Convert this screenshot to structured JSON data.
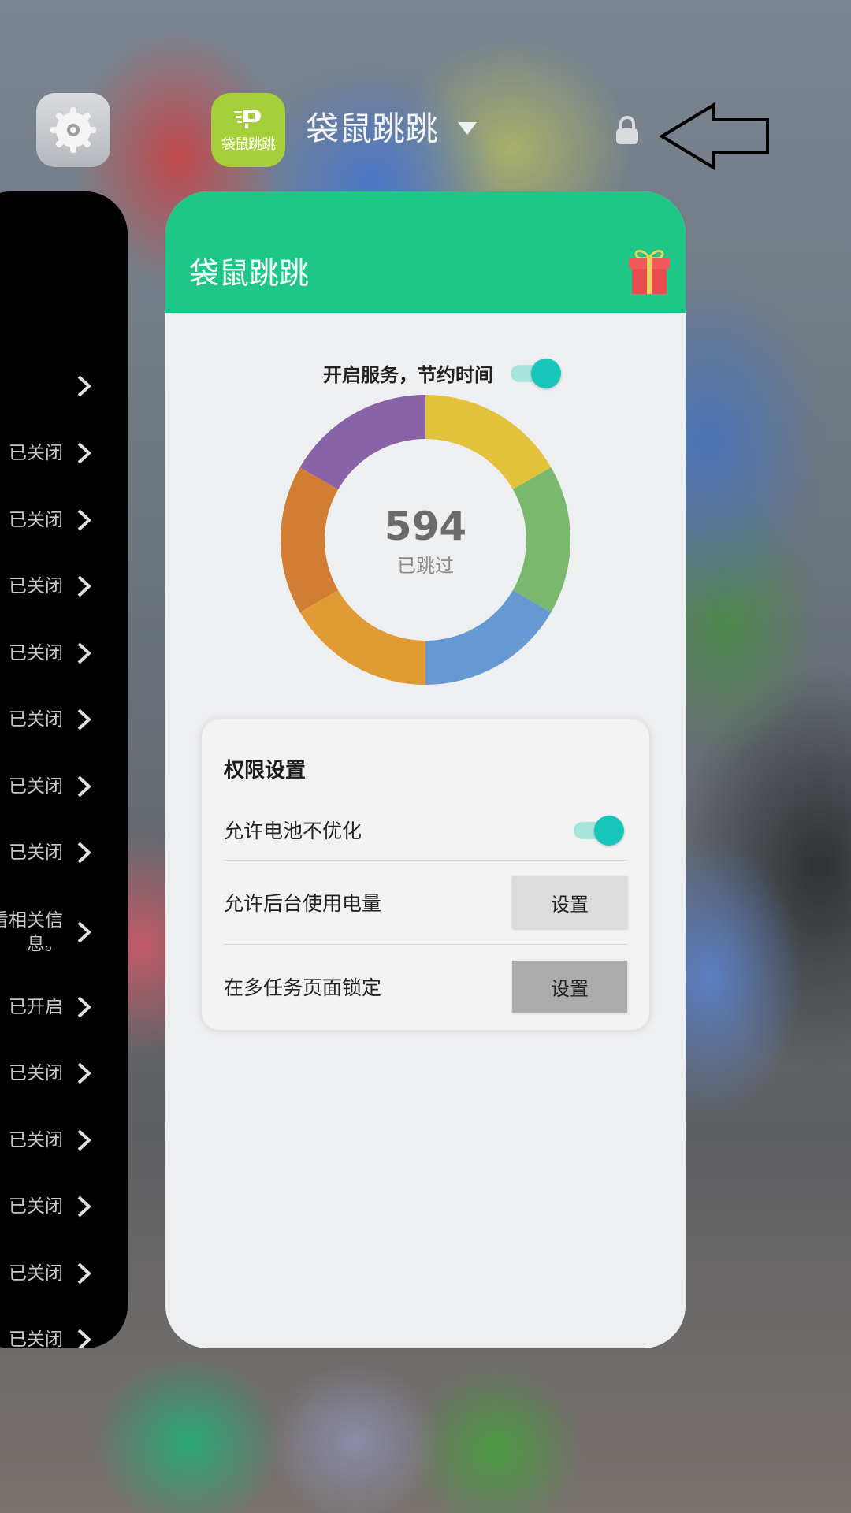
{
  "app_header": {
    "title": "袋鼠跳跳",
    "icon_label": "袋鼠跳跳"
  },
  "left_card": {
    "rows": [
      {
        "status": ""
      },
      {
        "status": "已关闭"
      },
      {
        "status": "已关闭"
      },
      {
        "status": "已关闭"
      },
      {
        "status": "已关闭"
      },
      {
        "status": "已关闭"
      },
      {
        "status": "已关闭"
      },
      {
        "status": "已关闭"
      },
      {
        "status": "看相关信息。"
      },
      {
        "status": "已开启"
      },
      {
        "status": "已关闭"
      },
      {
        "status": "已关闭"
      },
      {
        "status": "已关闭"
      },
      {
        "status": "已关闭"
      },
      {
        "status": "已关闭"
      }
    ]
  },
  "card": {
    "title": "袋鼠跳跳",
    "service_label": "开启服务，节约时间",
    "service_enabled": true,
    "skipped_count": "594",
    "skipped_label": "已跳过",
    "donut_colors": [
      "#e2c23a",
      "#7ab86d",
      "#6699d2",
      "#e09b35",
      "#d17d33",
      "#8863a8"
    ],
    "permissions": {
      "title": "权限设置",
      "battery_label": "允许电池不优化",
      "battery_enabled": true,
      "background_label": "允许后台使用电量",
      "background_button": "设置",
      "lock_label": "在多任务页面锁定",
      "lock_button": "设置"
    }
  },
  "colors": {
    "app_bar": "#1ec688",
    "toggle_accent": "#16c6ba",
    "app_icon_bg": "#a5cf3b"
  }
}
